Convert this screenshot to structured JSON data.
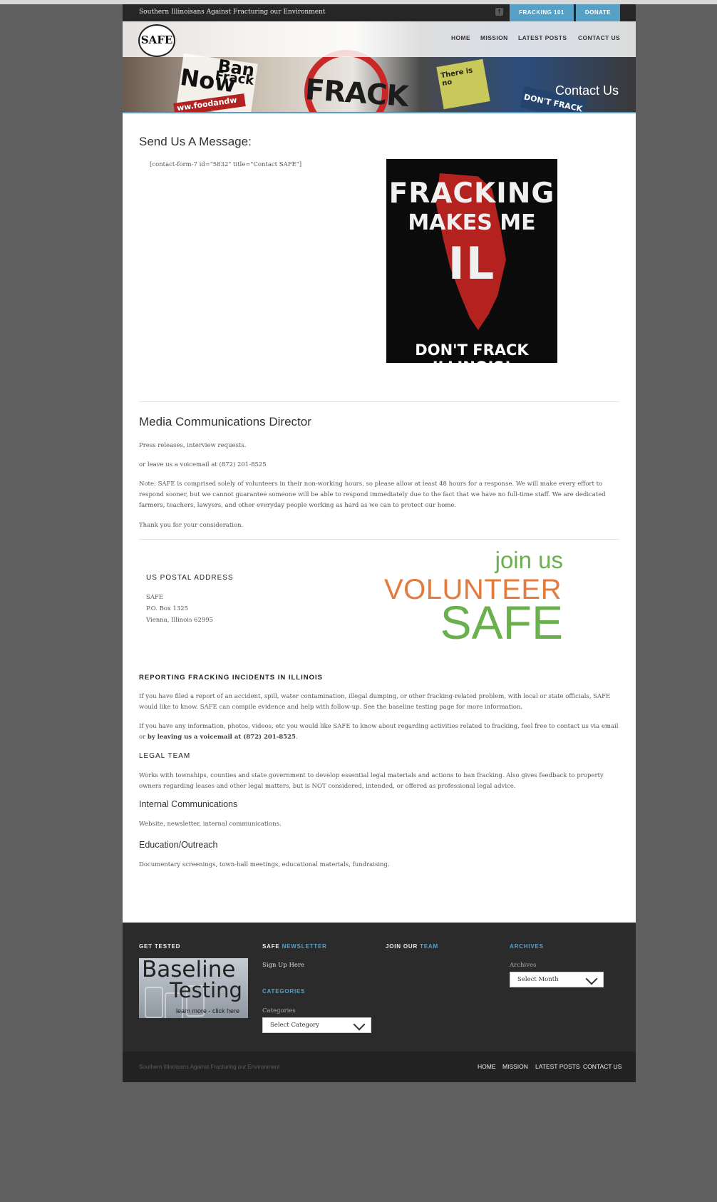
{
  "topbar": {
    "tagline": "Southern Illinoisans Against Fracturing our Environment",
    "social_icon": "facebook-icon",
    "fracking_label": "FRACKING 101",
    "donate_label": "DONATE"
  },
  "header": {
    "logo_text": "SAFE",
    "nav": [
      "HOME",
      "MISSION",
      "LATEST POSTS",
      "CONTACT US"
    ],
    "page_title": "Contact Us",
    "hero_signs": {
      "sign_a": "Ban",
      "sign_b": "Frack",
      "sign_c": "Now",
      "sign_d": "ww.foodandw",
      "sign_e": "FRACK",
      "sign_f": "There is no",
      "sign_g": "DON'T FRACK"
    }
  },
  "message_section": {
    "heading": "Send Us A Message:",
    "shortcode": "[contact-form-7 id=\"5832\" title=\"Contact SAFE\"]",
    "poster": {
      "line1": "FRACKING",
      "line2": "MAKES ME",
      "line3": "IL",
      "line4": "DON'T FRACK ILLINOIS!"
    }
  },
  "media_section": {
    "heading": "Media Communications Director",
    "p1": "Press releases, interview requests.",
    "p2": "or leave us a voicemail at (872) 201-8525",
    "p3": "Note: SAFE is comprised solely of volunteers in their non-working hours, so please allow at least 48 hours for a response.  We will make every effort to respond sooner, but we cannot guarantee someone will be able to respond immediately due to the fact that we have no full-time staff.  We are dedicated farmers, teachers, lawyers, and other everyday people working as hard as we can to protect our home.",
    "p4": "Thank you for your consideration."
  },
  "postal": {
    "heading": "US POSTAL ADDRESS",
    "line1": "SAFE",
    "line2": "P.O. Box 1325",
    "line3": "Vienna, Illinois 62995"
  },
  "volunteer": {
    "join": "join us",
    "volunteer": "VOLUNTEER",
    "safe": "SAFE"
  },
  "reporting": {
    "heading": "REPORTING FRACKING INCIDENTS IN ILLINOIS",
    "p1": "If you have filed a report of an accident, spill, water contamination, illegal dumping, or other fracking-related problem, with local or state officials, SAFE would like to know. SAFE can compile evidence and help with follow-up.  See the baseline testing page for more information.",
    "p2_start": "If you have any information, photos, videos, etc you would like SAFE to know about regarding activities related to fracking, feel free to contact us via email or ",
    "p2_bold": "by leaving us a voicemail at (872) 201-8525",
    "p2_end": "."
  },
  "legal": {
    "heading": "LEGAL TEAM",
    "text": "Works with townships, counties and state government to develop essential legal materials and actions to ban fracking.  Also gives feedback to property owners regarding leases and other legal matters, but is NOT considered, intended, or offered as professional legal advice."
  },
  "internal": {
    "heading": "Internal Communications",
    "text": "Website, newsletter, internal communications."
  },
  "education": {
    "heading": "Education/Outreach",
    "text": "Documentary screenings, town-hall meetings, educational materials, fundraising."
  },
  "footer": {
    "get_tested": "GET TESTED",
    "baseline_line1": "Baseline",
    "baseline_line2": "Testing",
    "baseline_line3": "learn more - click here",
    "newsletter_a": "SAFE",
    "newsletter_b": "NEWSLETTER",
    "signup": "Sign Up Here",
    "categories_heading": "CATEGORIES",
    "categories_label": "Categories",
    "categories_select": "Select Category",
    "join_a": "JOIN OUR",
    "join_b": "TEAM",
    "archives_heading": "ARCHIVES",
    "archives_label": "Archives",
    "archives_select": "Select Month"
  },
  "bottombar": {
    "copyright": "Southern Illinoisans Against Fracturing our Environment",
    "nav": [
      "HOME",
      "MISSION",
      "LATEST POSTS",
      "CONTACT US"
    ]
  },
  "colors": {
    "accent_blue": "#56a0c6",
    "volunteer_orange": "#e47a3b",
    "join_green": "#6ab04c",
    "topbar_dark": "#262626",
    "footer_dark": "#2b2b2b"
  }
}
